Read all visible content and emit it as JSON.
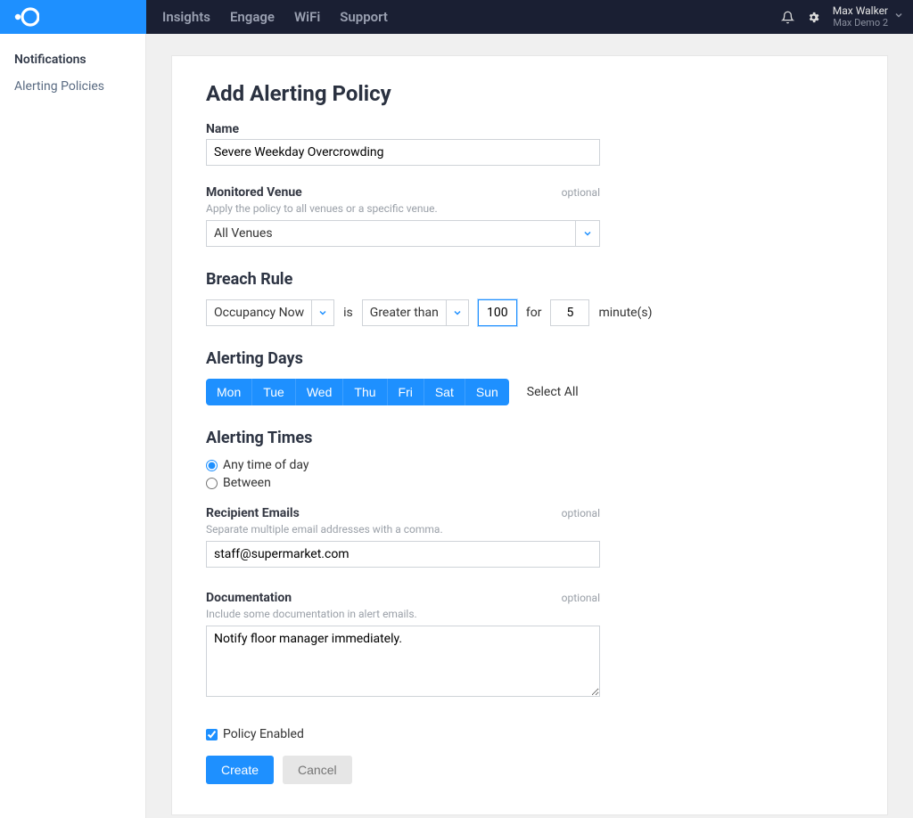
{
  "topnav": {
    "items": [
      "Insights",
      "Engage",
      "WiFi",
      "Support"
    ],
    "user_name": "Max Walker",
    "user_subtitle": "Max Demo 2"
  },
  "sidebar": {
    "items": [
      {
        "label": "Notifications",
        "active": false
      },
      {
        "label": "Alerting Policies",
        "active": true
      }
    ]
  },
  "page": {
    "title": "Add Alerting Policy",
    "name_label": "Name",
    "name_value": "Severe Weekday Overcrowding",
    "venue_label": "Monitored Venue",
    "venue_hint": "Apply the policy to all venues or a specific venue.",
    "venue_value": "All Venues",
    "optional_tag": "optional",
    "breach_heading": "Breach Rule",
    "breach": {
      "metric": "Occupancy Now",
      "is_text": "is",
      "comparator": "Greater than",
      "threshold": "100",
      "for_text": "for",
      "duration": "5",
      "minutes_text": "minute(s)"
    },
    "days_heading": "Alerting Days",
    "days": [
      "Mon",
      "Tue",
      "Wed",
      "Thu",
      "Fri",
      "Sat",
      "Sun"
    ],
    "select_all": "Select All",
    "times_heading": "Alerting Times",
    "times": {
      "any_label": "Any time of day",
      "between_label": "Between",
      "selected": "any"
    },
    "emails_label": "Recipient Emails",
    "emails_hint": "Separate multiple email addresses with a comma.",
    "emails_value": "staff@supermarket.com",
    "doc_label": "Documentation",
    "doc_hint": "Include some documentation in alert emails.",
    "doc_value": "Notify floor manager immediately.",
    "enabled_label": "Policy Enabled",
    "enabled_checked": true,
    "create_btn": "Create",
    "cancel_btn": "Cancel"
  }
}
